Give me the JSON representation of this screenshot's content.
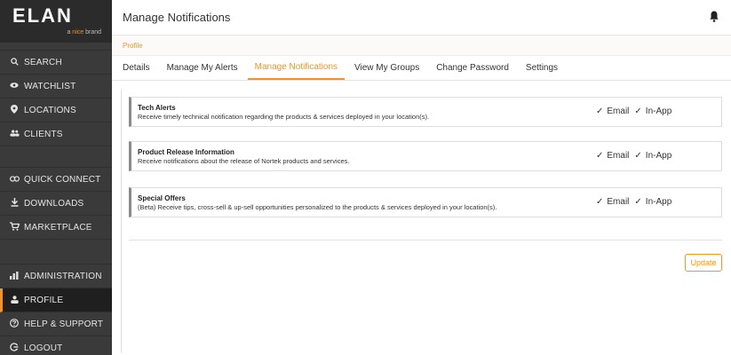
{
  "brand": {
    "logo": "ELAN",
    "sub_prefix": "a",
    "sub_highlight": "nice",
    "sub_suffix": "brand",
    "accent": "#f7941d"
  },
  "sidebar": {
    "items": [
      {
        "label": "SEARCH",
        "icon": "search-icon"
      },
      {
        "label": "WATCHLIST",
        "icon": "eye-icon"
      },
      {
        "label": "LOCATIONS",
        "icon": "location-pin-icon"
      },
      {
        "label": "CLIENTS",
        "icon": "users-icon"
      },
      {
        "label": "QUICK CONNECT",
        "icon": "link-icon"
      },
      {
        "label": "DOWNLOADS",
        "icon": "download-icon"
      },
      {
        "label": "MARKETPLACE",
        "icon": "cart-icon"
      },
      {
        "label": "ADMINISTRATION",
        "icon": "bar-chart-icon"
      },
      {
        "label": "PROFILE",
        "icon": "user-icon"
      },
      {
        "label": "HELP & SUPPORT",
        "icon": "help-icon"
      },
      {
        "label": "LOGOUT",
        "icon": "logout-icon"
      }
    ]
  },
  "header": {
    "title": "Manage Notifications",
    "breadcrumb": "Profile"
  },
  "tabs": [
    "Details",
    "Manage My Alerts",
    "Manage Notifications",
    "View My Groups",
    "Change Password",
    "Settings"
  ],
  "notifications": [
    {
      "title": "Tech Alerts",
      "desc": "Receive timely technical notification regarding the products & services deployed in your location(s).",
      "email": "Email",
      "inapp": "In-App"
    },
    {
      "title": "Product Release Information",
      "desc": "Receive notifications about the release of Nortek products and services.",
      "email": "Email",
      "inapp": "In-App"
    },
    {
      "title": "Special Offers",
      "desc": "(Beta) Receive tips, cross-sell & up-sell opportunities personalized to the products & services deployed in your location(s).",
      "email": "Email",
      "inapp": "In-App"
    }
  ],
  "actions": {
    "update": "Update"
  },
  "check_glyph": "✓"
}
